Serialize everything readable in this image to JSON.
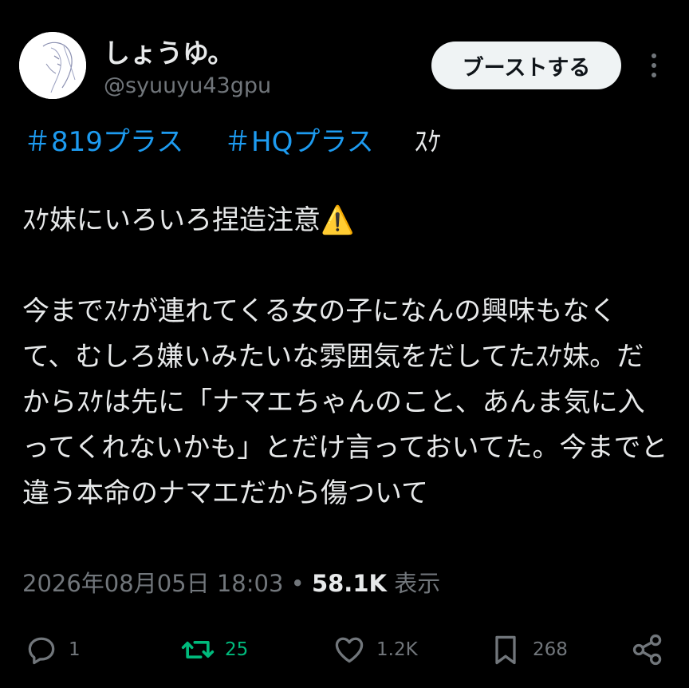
{
  "user": {
    "display_name": "しょうゆ。",
    "handle": "@syuuyu43gpu",
    "avatar_icon": "avatar-image"
  },
  "header": {
    "boost_label": "ブーストする",
    "more_icon": "more-vertical-icon"
  },
  "post": {
    "hashtags": [
      "＃819プラス",
      "＃HQプラス"
    ],
    "tag_tail": "ｽｹ",
    "body": "ｽｹ妹にいろいろ捏造注意⚠️\n\n今までｽｹが連れてくる女の子になんの興味もなくて、むしろ嫌いみたいな雰囲気をだしてたｽｹ妹。だからｽｹは先に「ナマエちゃんのこと、あんま気に入ってくれないかも」とだけ言っておいてた。今までと違う本命のナマエだから傷ついて",
    "timestamp": "2026年08月05日 18:03",
    "separator": "•",
    "views_count": "58.1K",
    "views_label": "表示"
  },
  "actions": {
    "reply_count": "1",
    "repost_count": "25",
    "like_count": "1.2K",
    "bookmark_count": "268"
  },
  "colors": {
    "background": "#000000",
    "text": "#e7e9ea",
    "muted": "#71767b",
    "link": "#1d9bf0",
    "repost_active": "#00ba7c"
  }
}
